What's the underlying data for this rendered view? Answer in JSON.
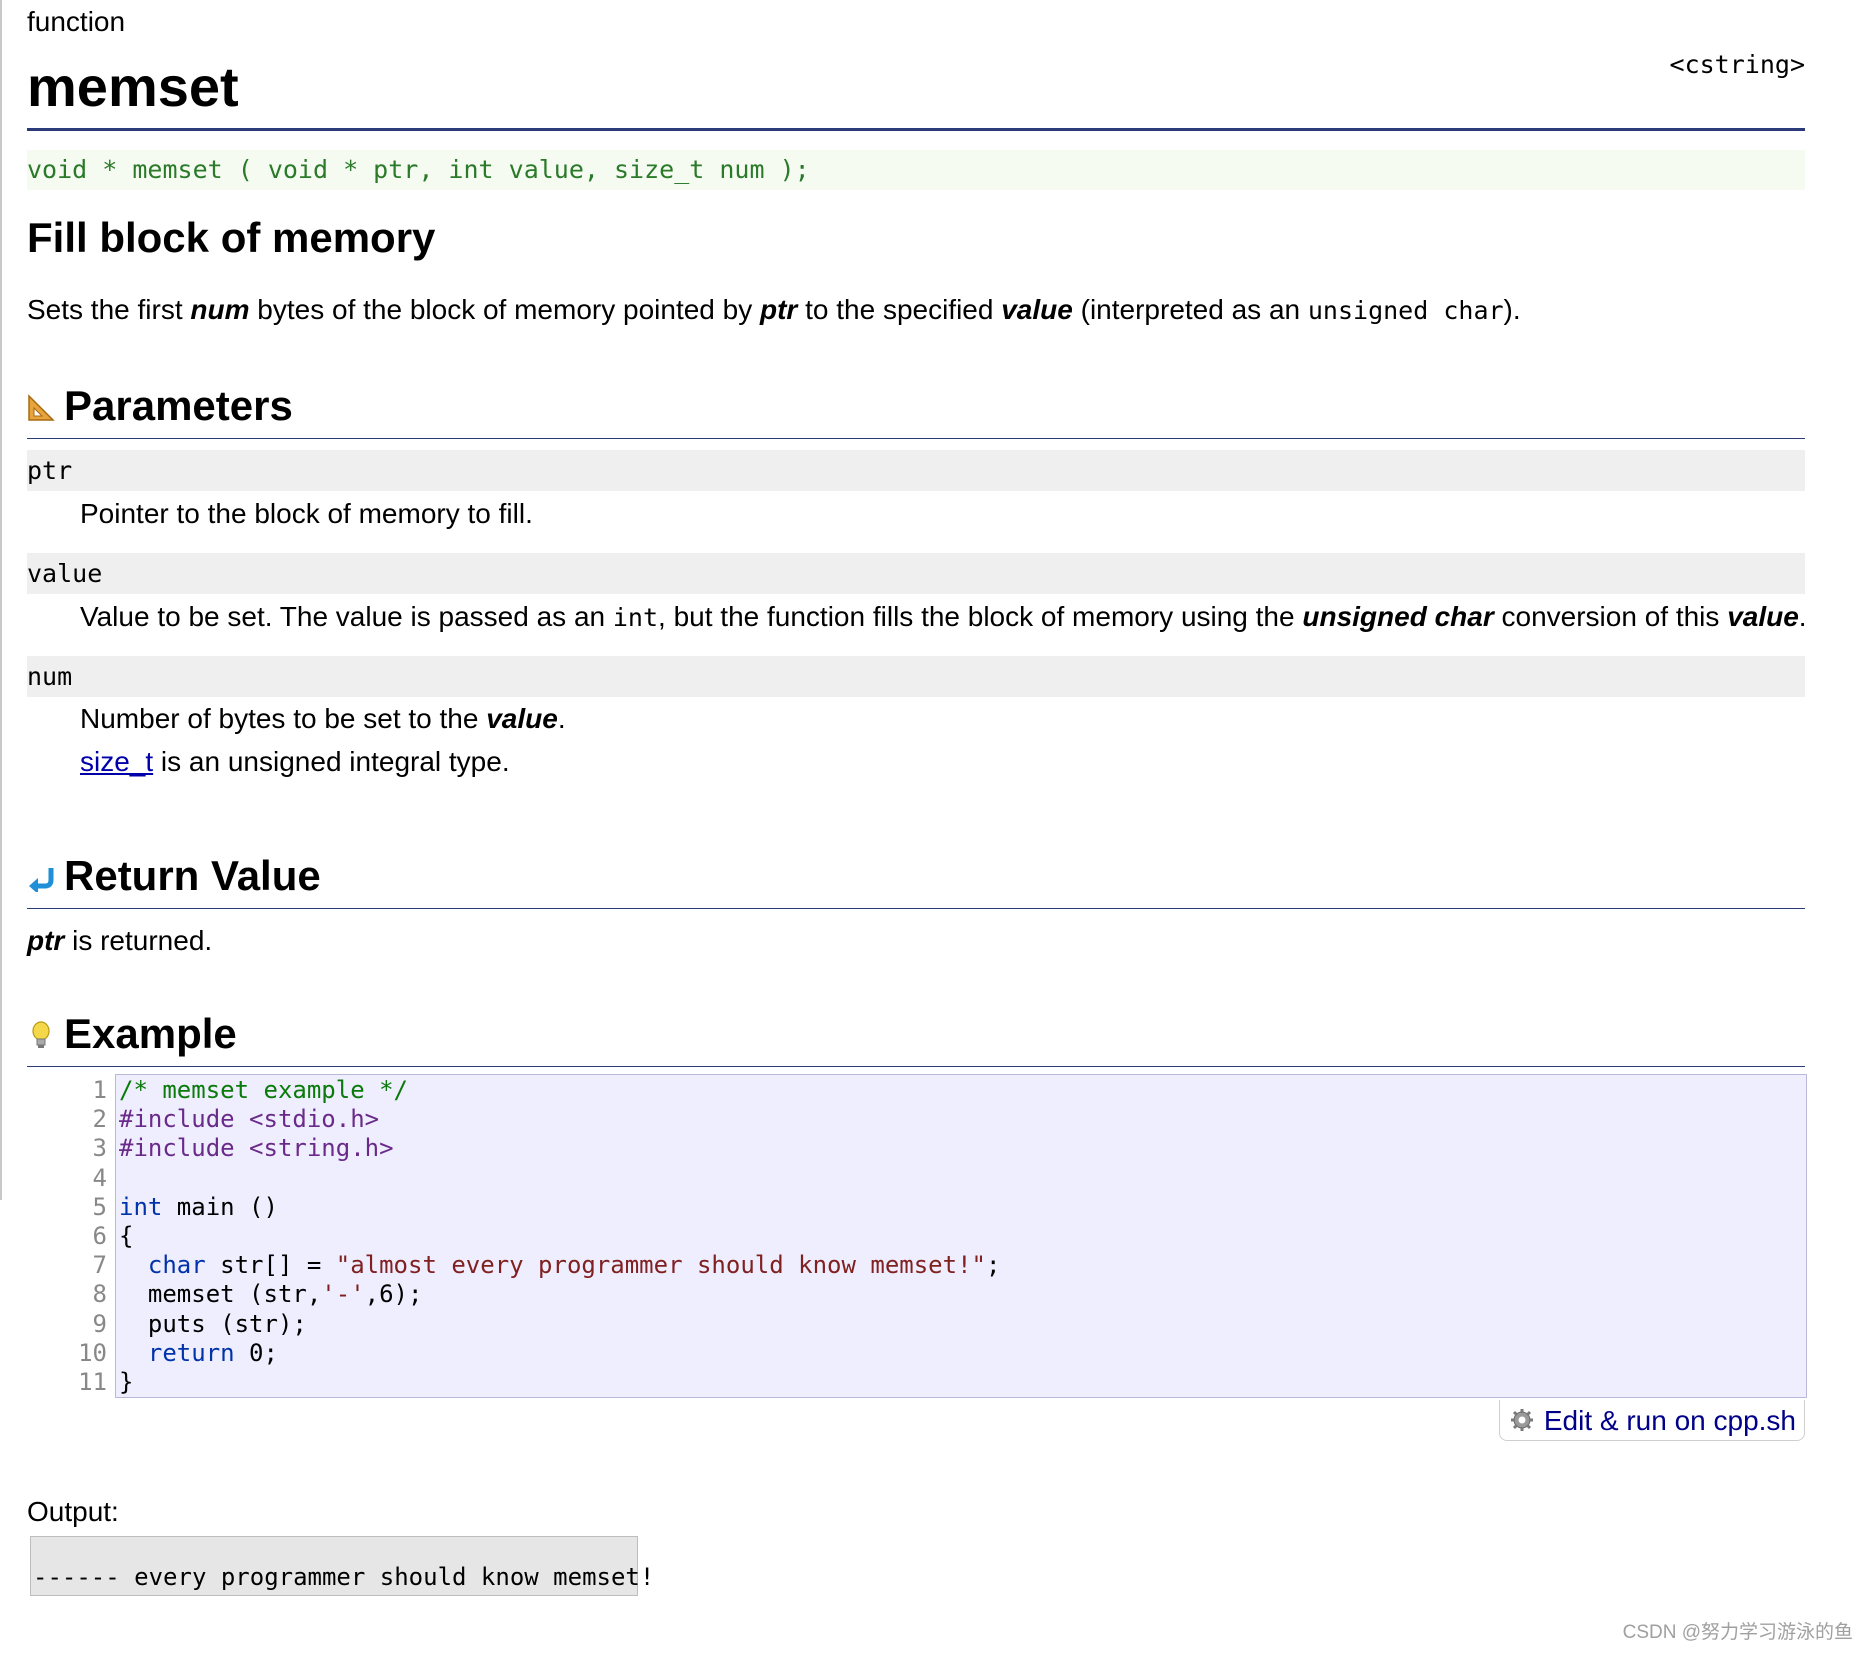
{
  "header": {
    "kind": "function",
    "name": "memset",
    "library": "<cstring>"
  },
  "prototype": "void * memset ( void * ptr, int value, size_t num );",
  "short_description": "Fill block of memory",
  "description": {
    "p1": "Sets the first ",
    "b1": "num",
    "p2": " bytes of the block of memory pointed by ",
    "b2": "ptr",
    "p3": " to the specified ",
    "b3": "value",
    "p4": " (interpreted as an ",
    "code": "unsigned char",
    "p5": ")."
  },
  "sections": {
    "parameters": "Parameters",
    "return_value": "Return Value",
    "example": "Example"
  },
  "parameters": {
    "ptr": {
      "name": "ptr",
      "desc": "Pointer to the block of memory to fill."
    },
    "value": {
      "name": "value",
      "p1": "Value to be set. The value is passed as an ",
      "code": "int",
      "p2": ", but the function fills the block of memory using the ",
      "b1": "unsigned char",
      "p3": " conversion of this ",
      "b2": "value",
      "p4": "."
    },
    "num": {
      "name": "num",
      "p1": "Number of bytes to be set to the ",
      "b1": "value",
      "p2": ".",
      "link": "size_t",
      "p3": " is an unsigned integral type."
    }
  },
  "return_value": {
    "b1": "ptr",
    "p1": " is returned."
  },
  "example": {
    "line_numbers": [
      "1",
      "2",
      "3",
      "4",
      "5",
      "6",
      "7",
      "8",
      "9",
      "10",
      "11"
    ],
    "l1": "/* memset example */",
    "l2": "#include <stdio.h>",
    "l3": "#include <string.h>",
    "l5_kw": "int",
    "l5_rest": " main ()",
    "l6": "{",
    "l7_kw": "char",
    "l7_mid": " str[] = ",
    "l7_str": "\"almost every programmer should know memset!\"",
    "l7_end": ";",
    "l8_a": "  memset (str,",
    "l8_str": "'-'",
    "l8_b": ",6);",
    "l9": "  puts (str);",
    "l10_kw": "return",
    "l10_rest": " 0;",
    "l11": "}",
    "run_button": "Edit & run on cpp.sh"
  },
  "output": {
    "label": "Output:",
    "text": "------ every programmer should know memset!"
  },
  "watermark": "CSDN @努力学习游泳的鱼"
}
